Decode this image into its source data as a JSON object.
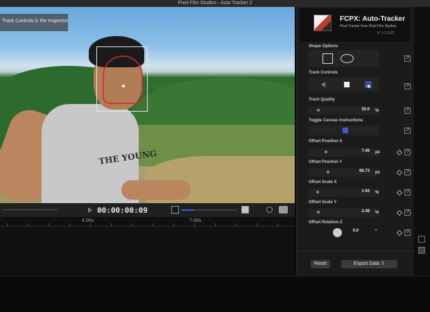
{
  "window": {
    "title": "Pixel Film Studios - Auto Tracker 2"
  },
  "viewer": {
    "hint_text": "Track Controls in the Inspector to",
    "shirt_text": "THE YOUNG"
  },
  "transport": {
    "timecode": "00:00:00:09",
    "volume_fraction": 0.22
  },
  "timeline": {
    "ruler_labels": [
      "4.00s",
      "7.00s"
    ]
  },
  "inspector": {
    "brand_title": "FCPX: Auto-Tracker",
    "brand_subtitle": "Pixel Tracker from Pixel Film Studios",
    "version": "V: 1.1.2.02",
    "sections": {
      "shape_options": "Shape Options",
      "track_controls": "Track Controls",
      "track_quality": "Track Quality",
      "toggle_canvas": "Toggle Canvas Instructions",
      "offset_position_x": "Offset Position X",
      "offset_position_y": "Offset Position Y",
      "offset_scale_x": "Offset Scale X",
      "offset_scale_y": "Offset Scale Y",
      "offset_rotation_z": "Offset Rotation Z"
    },
    "values": {
      "track_quality": "50.0",
      "offset_position_x": "7.49",
      "offset_position_y": "96.73",
      "offset_scale_x": "1.94",
      "offset_scale_y": "2.49",
      "offset_rotation_z": "0.0"
    },
    "units": {
      "percent": "%",
      "px": "px",
      "degree": "°"
    },
    "reset_label": "Reset",
    "export_label": "Export Data"
  },
  "colors": {
    "accent": "#4a59d8",
    "tracker_ring": "#d02c2c"
  }
}
